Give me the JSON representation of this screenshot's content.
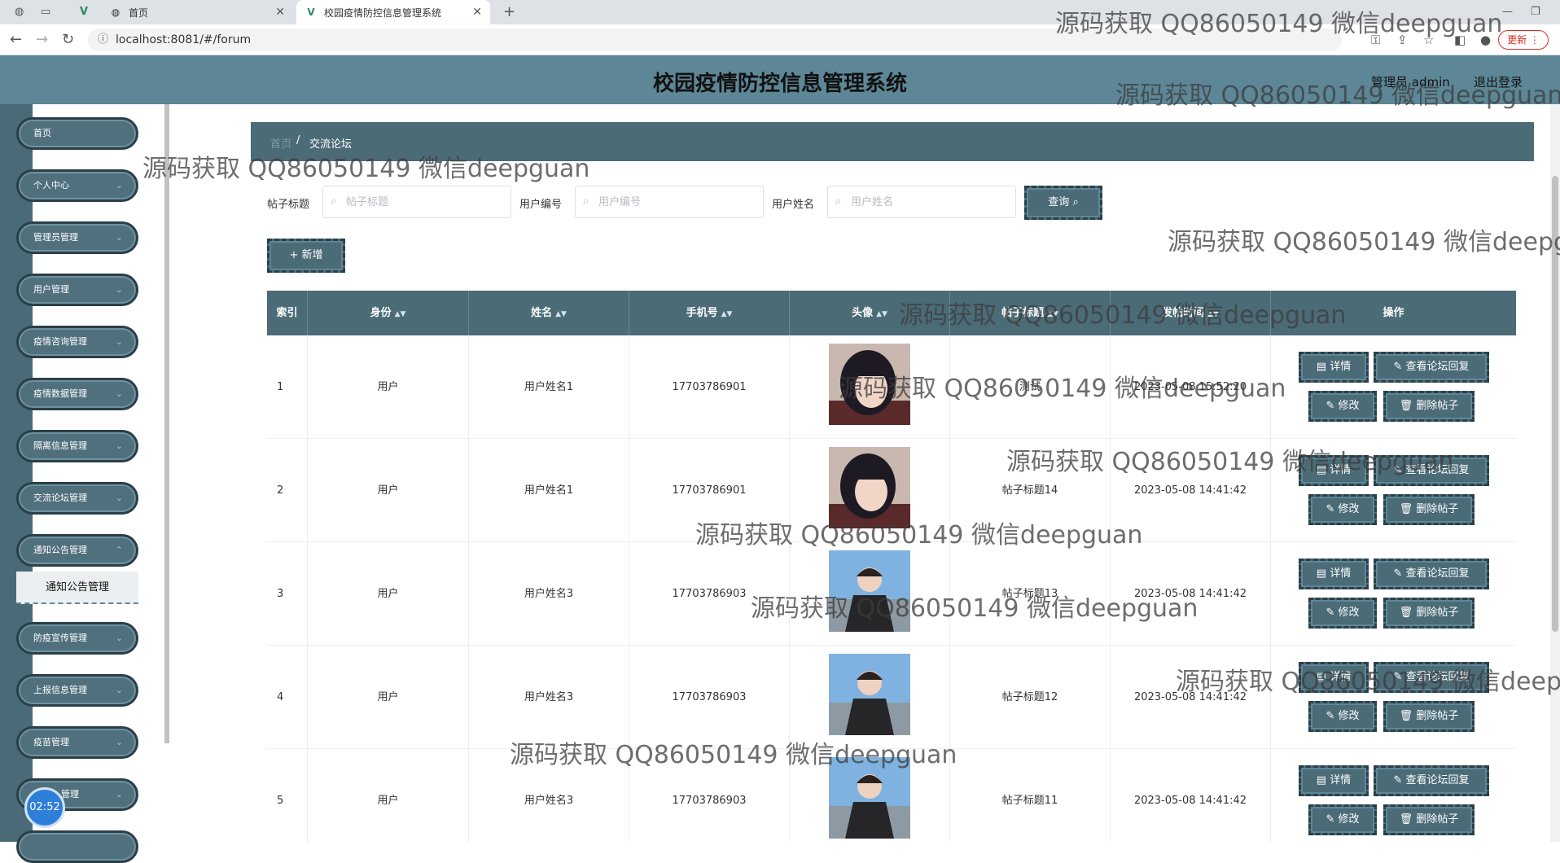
{
  "browser": {
    "tabs": [
      {
        "label": "首页"
      },
      {
        "label": "校园疫情防控信息管理系统"
      }
    ],
    "url": "localhost:8081/#/forum",
    "update_label": "更新"
  },
  "app": {
    "title": "校园疫情防控信息管理系统",
    "admin_label": "管理员 admin",
    "logout_label": "退出登录"
  },
  "sidebar": {
    "items": [
      {
        "label": "首页"
      },
      {
        "label": "个人中心"
      },
      {
        "label": "管理员管理"
      },
      {
        "label": "用户管理"
      },
      {
        "label": "疫情咨询管理"
      },
      {
        "label": "疫情数据管理"
      },
      {
        "label": "隔离信息管理"
      },
      {
        "label": "交流论坛管理"
      },
      {
        "label": "通知公告管理"
      },
      {
        "label": "防疫宣传管理"
      },
      {
        "label": "上报信息管理"
      },
      {
        "label": "疫苗管理"
      },
      {
        "label": "管理"
      }
    ],
    "open_submenu_item": "通知公告管理",
    "clock": "02:52"
  },
  "breadcrumb": {
    "home": "首页",
    "separator": "/",
    "current": "交流论坛"
  },
  "filters": [
    {
      "label": "帖子标题",
      "placeholder": "帖子标题"
    },
    {
      "label": "用户编号",
      "placeholder": "用户编号"
    },
    {
      "label": "用户姓名",
      "placeholder": "用户姓名"
    }
  ],
  "buttons": {
    "query": "查询",
    "add": "+ 新增"
  },
  "table": {
    "columns": [
      "索引",
      "身份",
      "姓名",
      "手机号",
      "头像",
      "帖子标题",
      "发帖时间",
      "操作"
    ],
    "rows": [
      {
        "index": "1",
        "identity": "用户",
        "name": "用户姓名1",
        "phone": "17703786901",
        "avatar": "girl",
        "title": "测试",
        "time": "2023-05-08 15:52:20"
      },
      {
        "index": "2",
        "identity": "用户",
        "name": "用户姓名1",
        "phone": "17703786901",
        "avatar": "girl",
        "title": "帖子标题14",
        "time": "2023-05-08 14:41:42"
      },
      {
        "index": "3",
        "identity": "用户",
        "name": "用户姓名3",
        "phone": "17703786903",
        "avatar": "boy",
        "title": "帖子标题13",
        "time": "2023-05-08 14:41:42"
      },
      {
        "index": "4",
        "identity": "用户",
        "name": "用户姓名3",
        "phone": "17703786903",
        "avatar": "boy",
        "title": "帖子标题12",
        "time": "2023-05-08 14:41:42"
      },
      {
        "index": "5",
        "identity": "用户",
        "name": "用户姓名3",
        "phone": "17703786903",
        "avatar": "boy",
        "title": "帖子标题11",
        "time": "2023-05-08 14:41:42"
      }
    ],
    "actions": {
      "detail": "详情",
      "view_replies": "查看论坛回复",
      "edit": "修改",
      "delete": "删除帖子"
    }
  },
  "watermark": "源码获取 QQ86050149 微信deepguan",
  "colors": {
    "header": "#5d8797",
    "dark": "#4b6b77",
    "sidebar_strip": "#4a6a78"
  }
}
